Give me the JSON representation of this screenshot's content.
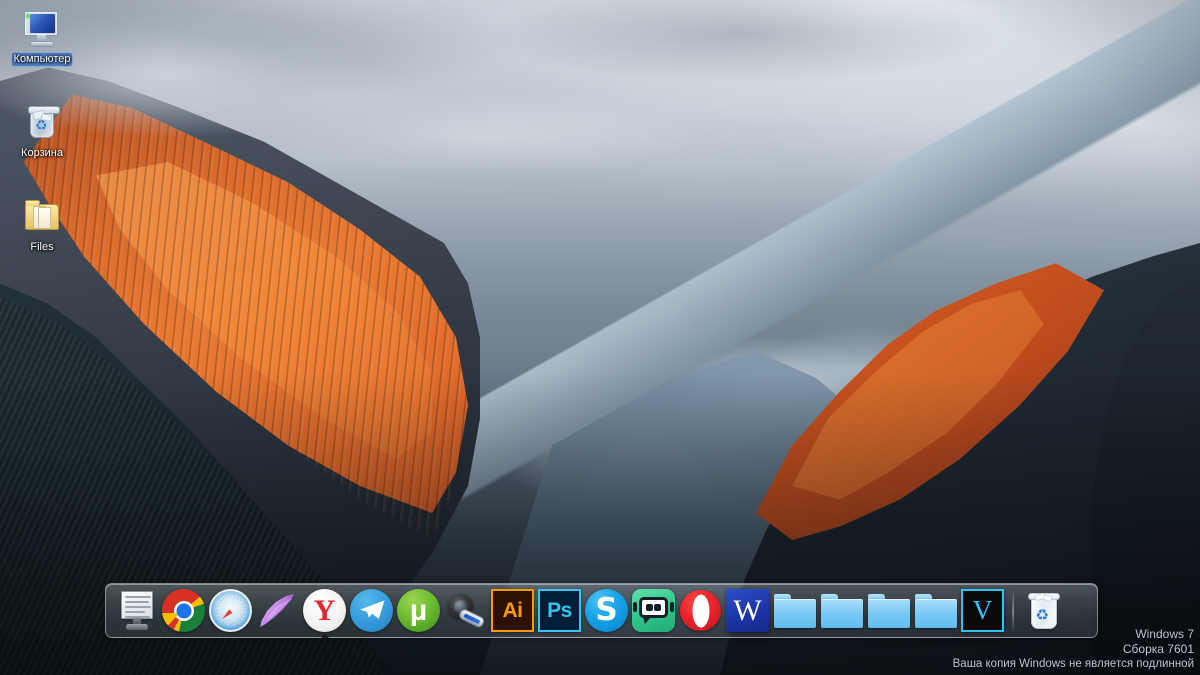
{
  "desktop": {
    "wallpaper_name": "os-x-el-capitan-wallpaper",
    "icons": [
      {
        "name": "computer",
        "label": "Компьютер",
        "icon": "monitor-icon",
        "selected": true
      },
      {
        "name": "recycle-bin",
        "label": "Корзина",
        "icon": "recycle-bin-icon",
        "selected": false
      },
      {
        "name": "files-folder",
        "label": "Files",
        "icon": "folder-icon",
        "selected": false
      }
    ]
  },
  "dock": {
    "items": [
      {
        "label": "Notepad",
        "icon": "notepad-icon",
        "running": false
      },
      {
        "label": "Google Chrome",
        "icon": "chrome-icon",
        "running": false
      },
      {
        "label": "Safari",
        "icon": "safari-icon",
        "running": false
      },
      {
        "label": "Feather",
        "icon": "feather-icon",
        "running": false
      },
      {
        "label": "Yandex Browser",
        "icon": "yandex-icon",
        "running": true,
        "badge": "Y"
      },
      {
        "label": "Telegram",
        "icon": "telegram-icon",
        "running": false
      },
      {
        "label": "uTorrent",
        "icon": "utorrent-icon",
        "running": false,
        "badge": "µ"
      },
      {
        "label": "Tools",
        "icon": "wrench-icon",
        "running": false
      },
      {
        "label": "Adobe Illustrator",
        "icon": "illustrator-icon",
        "running": false,
        "badge": "Ai"
      },
      {
        "label": "Adobe Photoshop",
        "icon": "photoshop-icon",
        "running": false,
        "badge": "Ps"
      },
      {
        "label": "Skype",
        "icon": "skype-icon",
        "running": false,
        "badge": "S"
      },
      {
        "label": "Streamlabs",
        "icon": "streamlabs-icon",
        "running": false
      },
      {
        "label": "Opera",
        "icon": "opera-icon",
        "running": false,
        "badge": "O"
      },
      {
        "label": "Microsoft Word",
        "icon": "word-icon",
        "running": false,
        "badge": "W"
      },
      {
        "label": "Folder 1",
        "icon": "folder-icon",
        "running": false
      },
      {
        "label": "Folder 2",
        "icon": "folder-icon",
        "running": false
      },
      {
        "label": "Folder 3",
        "icon": "folder-icon",
        "running": false
      },
      {
        "label": "Folder 4",
        "icon": "folder-icon",
        "running": false
      },
      {
        "label": "Sony Vegas",
        "icon": "vegas-icon",
        "running": false,
        "badge": "V"
      }
    ],
    "separator": true,
    "trash": {
      "label": "Trash",
      "icon": "trash-icon"
    }
  },
  "watermark": {
    "line1": "Windows 7",
    "line2": "Сборка 7601",
    "line3": "Ваша копия Windows не является подлинной"
  },
  "colors": {
    "accent_blue": "#2ec2ff",
    "illustrator_orange": "#ff9a00",
    "photoshop_blue": "#31c5f0",
    "word_blue": "#1c35a8",
    "opera_red": "#e8232b",
    "yandex_red": "#e8262b",
    "selection_blue": "#316ac5",
    "folder_blue": "#79c9f4",
    "watermark_text": "#ccd6e2"
  }
}
